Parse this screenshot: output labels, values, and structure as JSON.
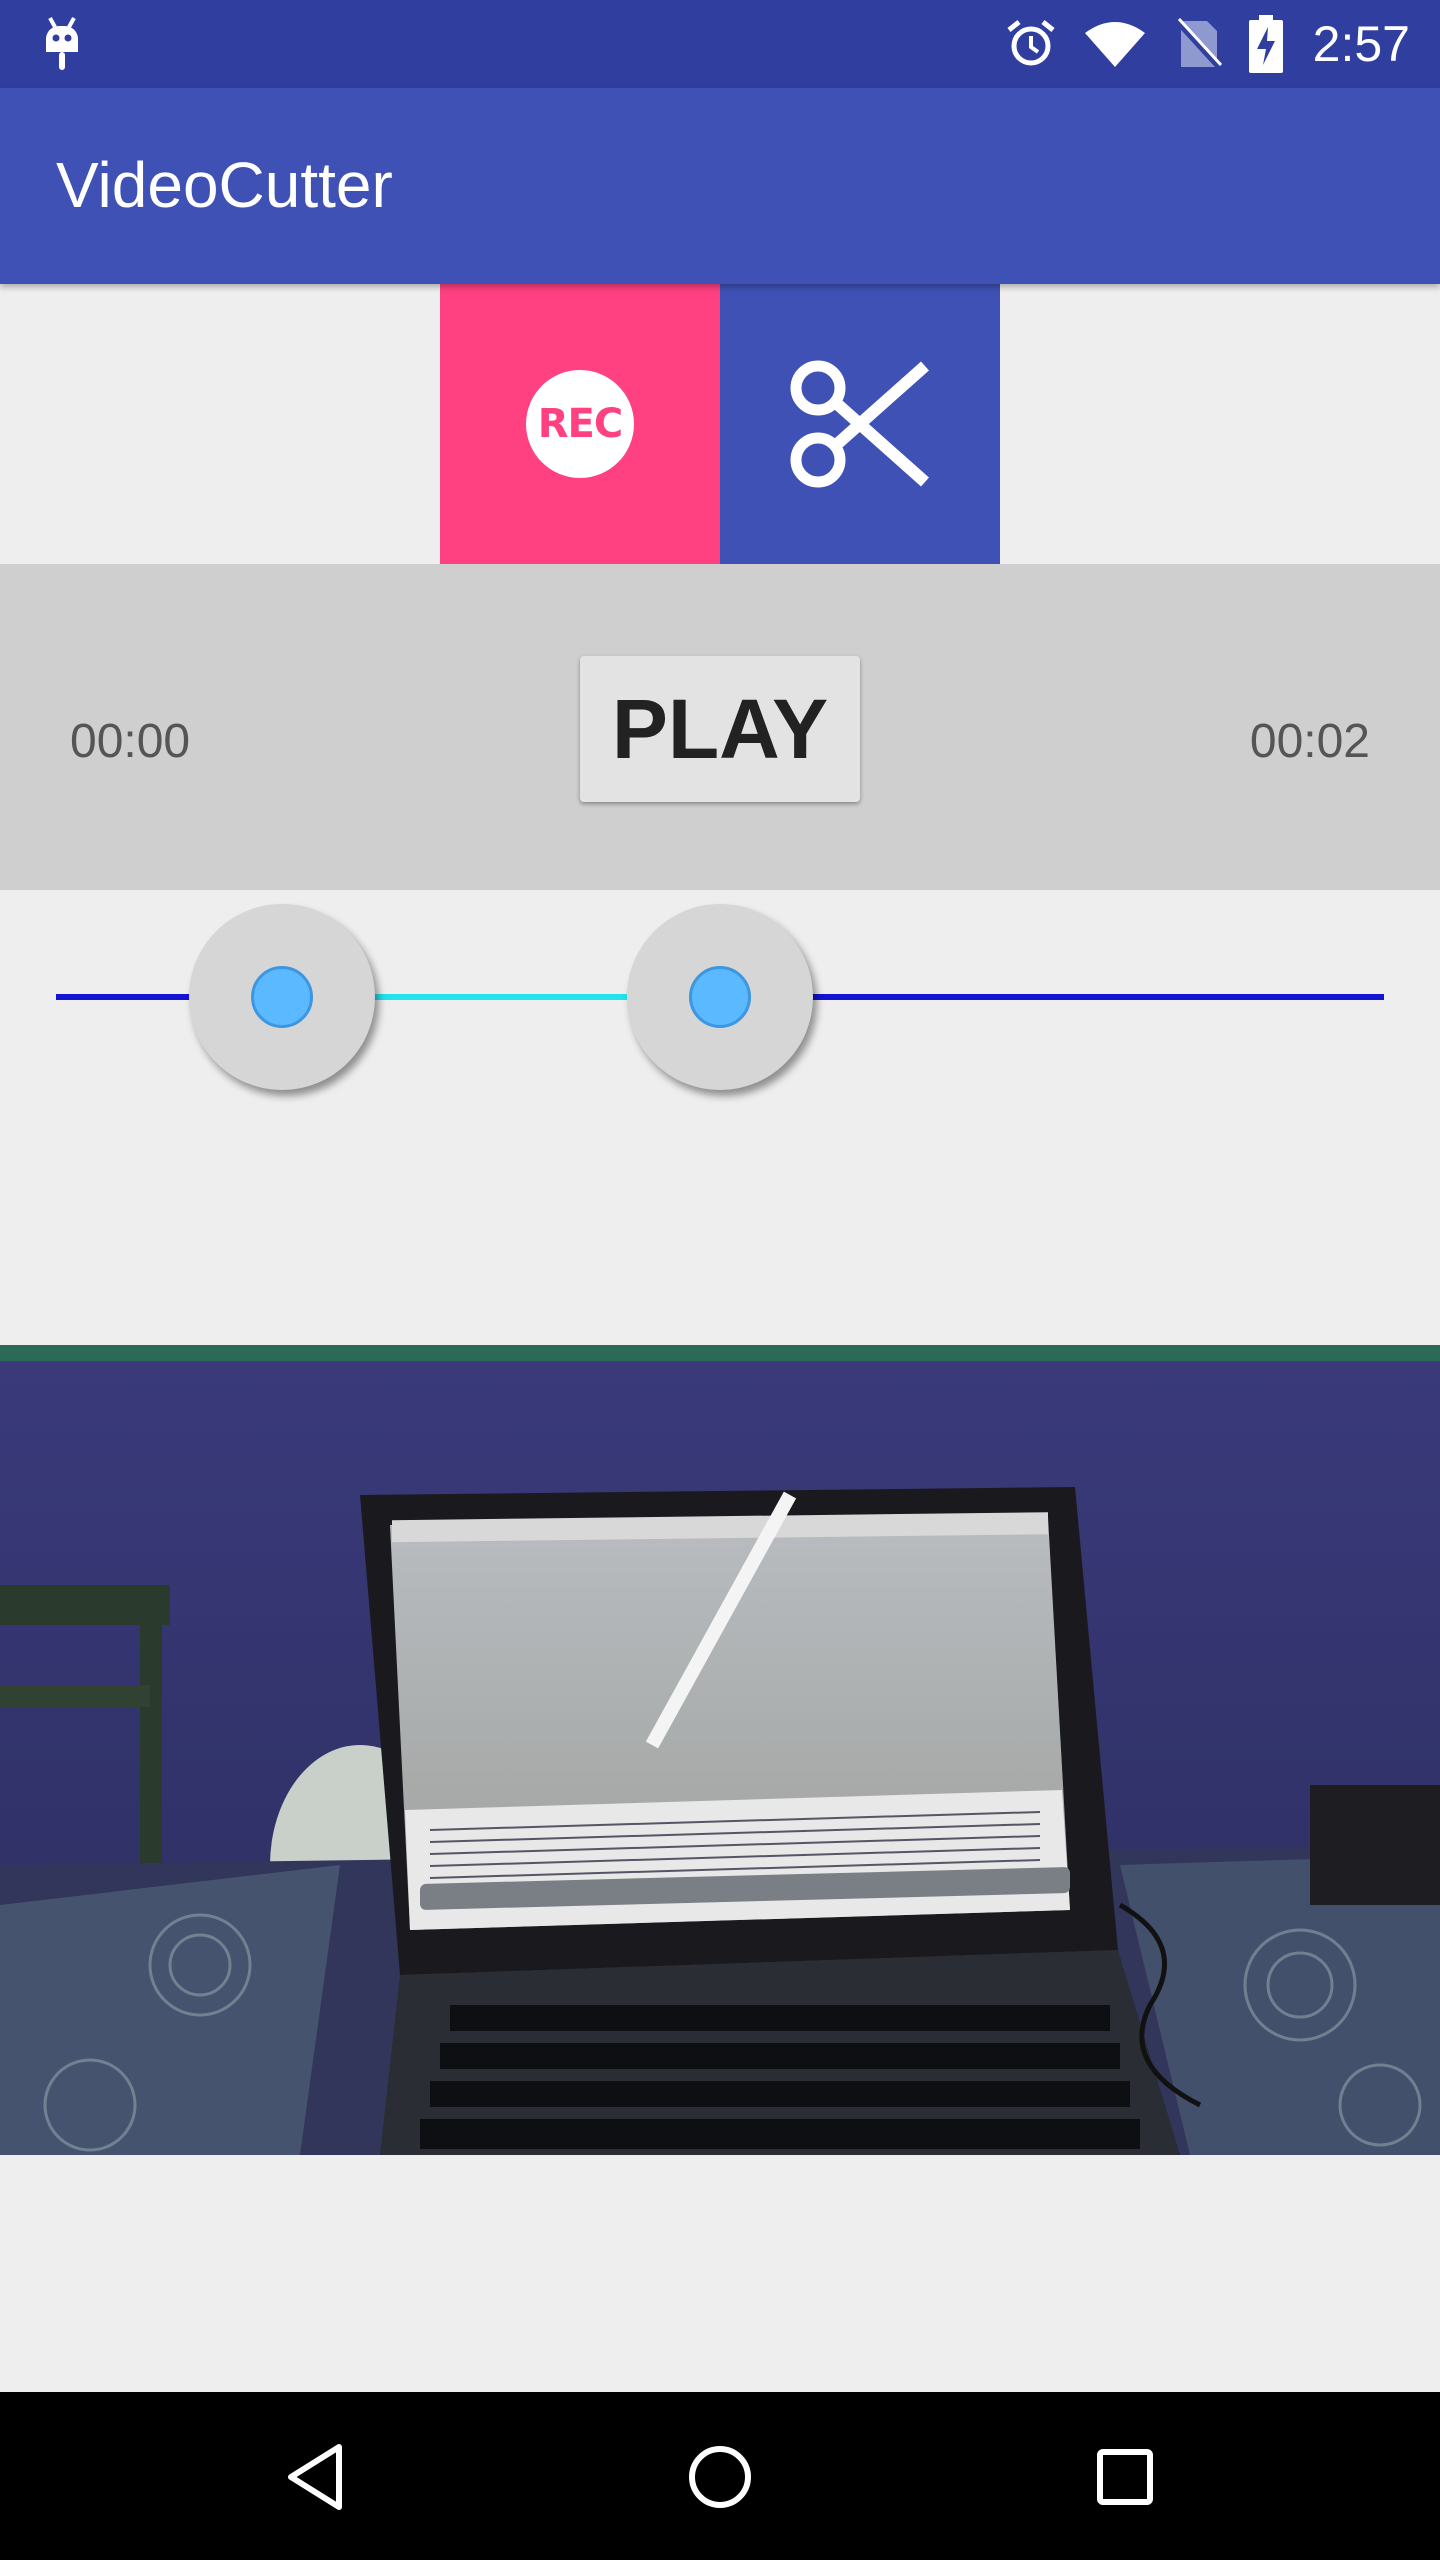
{
  "status_bar": {
    "time": "2:57",
    "icons": [
      "android-icon",
      "alarm-icon",
      "wifi-icon",
      "no-sim-icon",
      "battery-charging-icon"
    ]
  },
  "app_bar": {
    "title": "VideoCutter"
  },
  "actions": {
    "record_label": "REC",
    "record_icon": "rec-icon",
    "cut_icon": "scissors-icon"
  },
  "player": {
    "start_time": "00:00",
    "end_time": "00:02",
    "play_label": "PLAY"
  },
  "range_slider": {
    "min": 0,
    "max": 1,
    "selected_start": 0.17,
    "selected_end": 0.5
  },
  "preview": {
    "icon": "video-preview-image"
  },
  "nav_bar": {
    "icons": [
      "back-icon",
      "home-icon",
      "recents-icon"
    ]
  },
  "colors": {
    "status_bar": "#303f9f",
    "primary": "#3f51b5",
    "accent": "#ff4081",
    "track": "#1414d2",
    "track_selected": "#22e3ee",
    "thumb_dot": "#5ab9ff"
  }
}
